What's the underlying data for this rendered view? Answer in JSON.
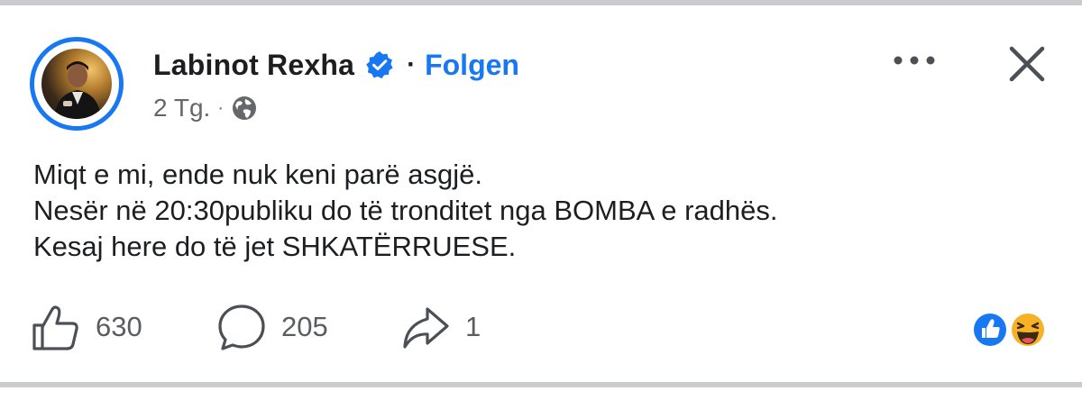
{
  "post": {
    "author": "Labinot Rexha",
    "follow_label": "Folgen",
    "separator": "·",
    "timestamp": "2 Tg.",
    "audience_icon": "globe-icon",
    "verified_icon": "verified-badge-icon",
    "lines": [
      "Miqt e mi, ende nuk keni parë asgjë.",
      "Nesër në 20:30publiku do të tronditet nga BOMBA e radhës.",
      "Kesaj here do të jet SHKATËRRUESE."
    ]
  },
  "actions": {
    "likes": "630",
    "comments": "205",
    "shares": "1"
  },
  "reactions": [
    "like-reaction-icon",
    "haha-reaction-icon"
  ],
  "colors": {
    "accent": "#1877f2",
    "text": "#1c1e21",
    "muted": "#65676b",
    "divider": "#c9cbcf"
  }
}
